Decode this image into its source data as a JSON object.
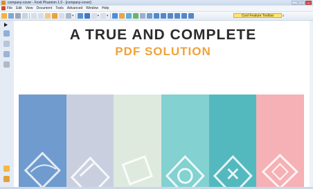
{
  "window": {
    "title": "company-cover - Foxit Phantom 1.0 - [company-cover]"
  },
  "menu": {
    "items": [
      "File",
      "Edit",
      "View",
      "Document",
      "Tools",
      "Advanced",
      "Window",
      "Help"
    ]
  },
  "toolbar": {
    "cool_feature_label": "Cool Feature Toolbar",
    "close_glyph": "x"
  },
  "document": {
    "headline": "A TRUE AND COMPLETE",
    "subline": "PDF SOLUTION"
  },
  "colors": {
    "stripes": [
      "#6f9bcf",
      "#c9cfdf",
      "#dfeadf",
      "#83d1d1",
      "#54b9be",
      "#f5b1b5"
    ],
    "accent": "#f0a23a"
  }
}
